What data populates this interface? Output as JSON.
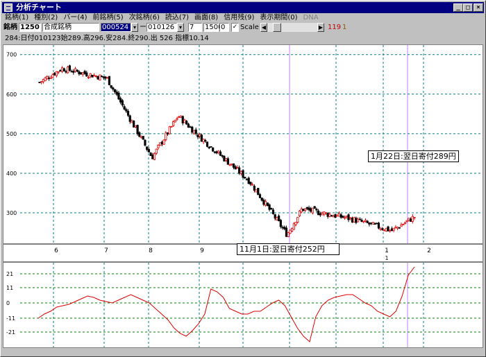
{
  "window": {
    "title": "分析チャート"
  },
  "menu": [
    "銘柄(1)",
    "種別(2)",
    "バー(4)",
    "前銘柄(5)",
    "次銘柄(6)",
    "読込(7)",
    "画面(8)",
    "信用残(9)",
    "表示期間(0)",
    "DNA"
  ],
  "toolbar": {
    "code_label": "銘柄",
    "code": "1250",
    "name": "合成銘柄",
    "start_date": "000524",
    "dash": "ー",
    "end_date": "010126",
    "num1": "7",
    "num2": "1500",
    "num3": "0",
    "scale_label": "Scale",
    "val1": "119",
    "val2": "1"
  },
  "info_line": "284:日付010123始289.高296.安284.終290.出 526 指標10.14",
  "chart_data": [
    {
      "type": "candlestick",
      "ylim": [
        230,
        710
      ],
      "yticks": [
        300,
        400,
        500,
        600,
        700
      ],
      "xtick_labels": [
        "6",
        "7",
        "8",
        "9",
        "1",
        "2"
      ],
      "sub_xtick_labels": [
        "1"
      ],
      "ohlc_sample": [
        {
          "x": "start",
          "close": 630
        },
        {
          "x": "6",
          "close": 665
        },
        {
          "x": "7",
          "close": 640
        },
        {
          "x": "8",
          "close": 440
        },
        {
          "x": "8.5",
          "close": 545
        },
        {
          "x": "9",
          "close": 490
        },
        {
          "x": "10",
          "close": 380
        },
        {
          "x": "11/1",
          "close": 245
        },
        {
          "x": "11",
          "close": 310
        },
        {
          "x": "12",
          "close": 285
        },
        {
          "x": "1",
          "close": 255
        },
        {
          "x": "end",
          "close": 290
        }
      ],
      "annotations": [
        "1月22日:翌日寄付289円",
        "11月1日:翌日寄付252円"
      ]
    },
    {
      "type": "line",
      "ylim": [
        -30,
        26
      ],
      "yticks": [
        21,
        11,
        0,
        -11,
        -21
      ],
      "series": [
        {
          "values": [
            -11,
            -8,
            -6,
            -3,
            -2,
            -1,
            1,
            3,
            5,
            4,
            2,
            1,
            0,
            2,
            4,
            6,
            4,
            2,
            0,
            -4,
            -8,
            -12,
            -18,
            -22,
            -24,
            -20,
            -15,
            -8,
            10,
            8,
            4,
            -4,
            -6,
            -8,
            -8,
            -6,
            -6,
            -3,
            0,
            2,
            -2,
            -10,
            -18,
            -24,
            -28,
            -10,
            -2,
            2,
            4,
            5,
            6,
            6,
            3,
            0,
            -2,
            -6,
            -8,
            -10,
            -6,
            5,
            20,
            26
          ]
        }
      ]
    }
  ]
}
